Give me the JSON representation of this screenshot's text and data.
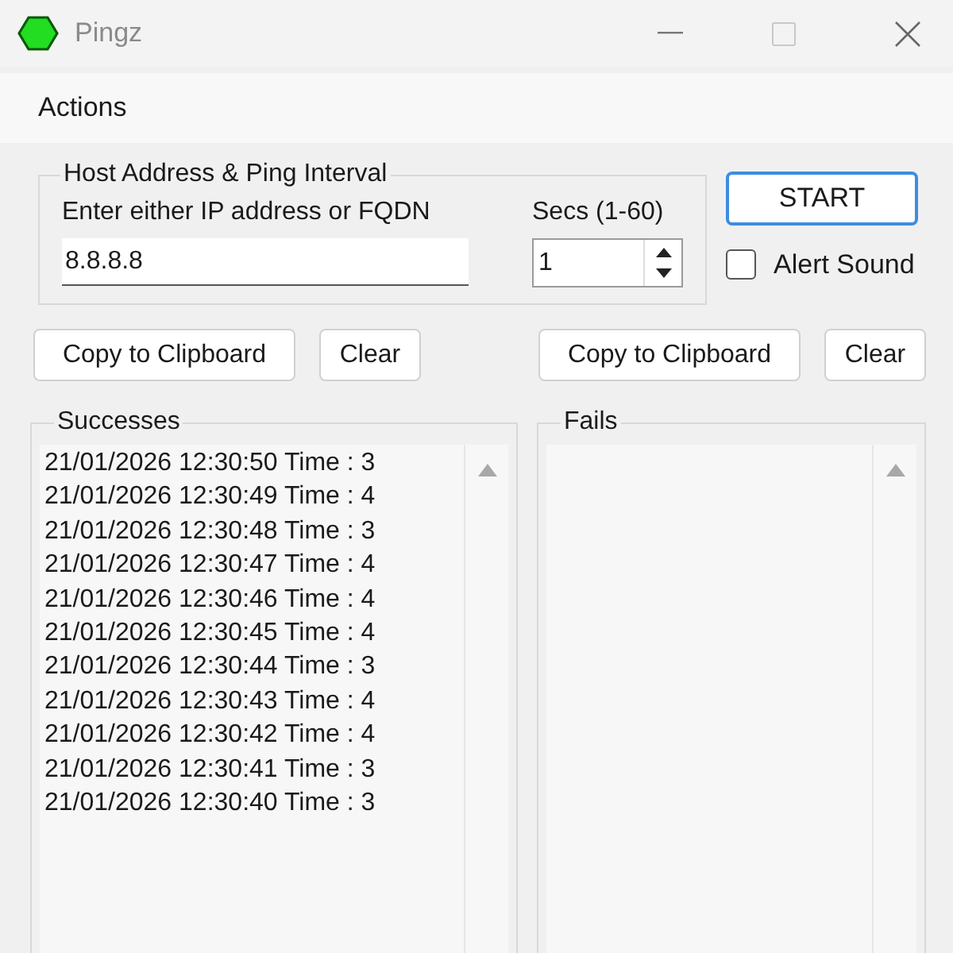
{
  "window": {
    "title": "Pingz"
  },
  "menu": [
    "Actions"
  ],
  "host_group": {
    "title": "Host Address & Ping Interval",
    "address_label": "Enter either IP address or FQDN",
    "address_value": "8.8.8.8",
    "interval_label": "Secs (1-60)",
    "interval_value": "1"
  },
  "start_button": "START",
  "alert_sound": {
    "label": "Alert Sound",
    "checked": false
  },
  "successes": {
    "copy_button": "Copy to Clipboard",
    "clear_button": "Clear",
    "title": "Successes",
    "items": [
      "21/01/2026 12:30:50 Time : 3",
      "21/01/2026 12:30:49 Time : 4",
      "21/01/2026 12:30:48 Time : 3",
      "21/01/2026 12:30:47 Time : 4",
      "21/01/2026 12:30:46 Time : 4",
      "21/01/2026 12:30:45 Time : 4",
      "21/01/2026 12:30:44 Time : 3",
      "21/01/2026 12:30:43 Time : 4",
      "21/01/2026 12:30:42 Time : 4",
      "21/01/2026 12:30:41 Time : 3",
      "21/01/2026 12:30:40 Time : 3"
    ]
  },
  "fails": {
    "copy_button": "Copy to Clipboard",
    "clear_button": "Clear",
    "title": "Fails"
  }
}
